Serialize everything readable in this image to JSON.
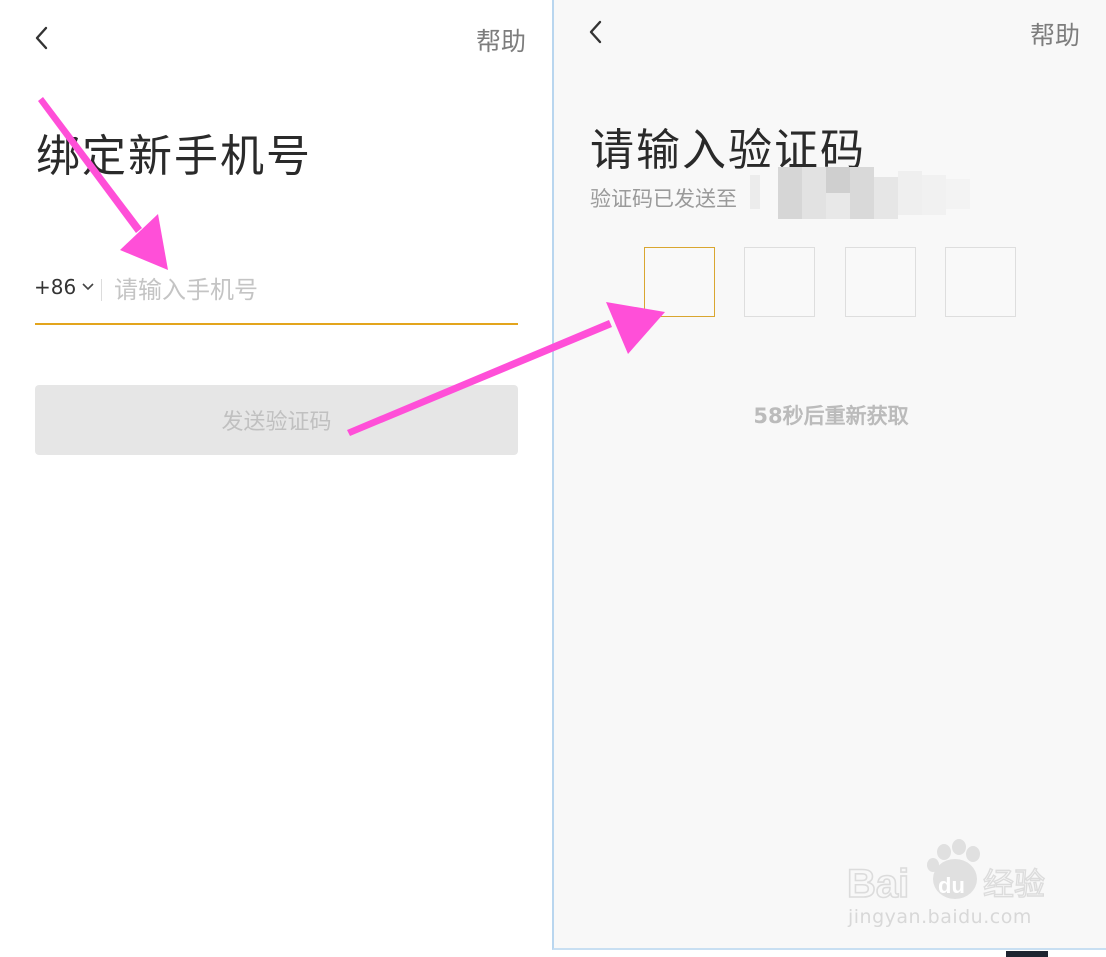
{
  "left_screen": {
    "help_label": "帮助",
    "title": "绑定新手机号",
    "country_code": "+86",
    "phone_placeholder": "请输入手机号",
    "send_button_label": "发送验证码",
    "accent_color": "#e3a51d"
  },
  "right_screen": {
    "help_label": "帮助",
    "title": "请输入验证码",
    "sent_prefix": "验证码已发送至",
    "code_box_count": 4,
    "resend_countdown": "58秒后重新获取"
  },
  "watermark": {
    "brand": "Bai du 经验",
    "url": "jingyan.baidu.com"
  },
  "annotation_color": "#ff4fd8",
  "icons": [
    "chevron-left-icon",
    "chevron-down-icon",
    "paw-icon"
  ]
}
